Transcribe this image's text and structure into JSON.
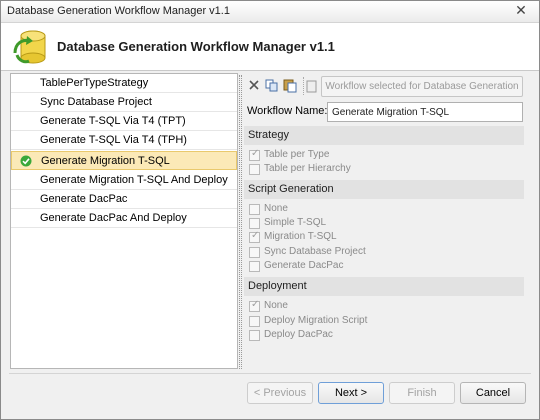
{
  "window": {
    "title": "Database Generation Workflow Manager v1.1",
    "close_glyph": "✕"
  },
  "header": {
    "heading": "Database Generation Workflow Manager v1.1",
    "logo_icon": "database-workflow-icon"
  },
  "steps": [
    {
      "label": "TablePerTypeStrategy"
    },
    {
      "label": "Sync Database Project"
    },
    {
      "label": "Generate T-SQL Via T4 (TPT)"
    },
    {
      "label": "Generate T-SQL Via T4 (TPH)"
    },
    {
      "label": "Generate Migration T-SQL",
      "selected": true
    },
    {
      "label": "Generate Migration T-SQL And Deploy"
    },
    {
      "label": "Generate DacPac"
    },
    {
      "label": "Generate DacPac And Deploy"
    }
  ],
  "toolbar": {
    "workflow_button": "Workflow selected for Database Generation",
    "icons": [
      "delete-icon",
      "copy-icon",
      "paste-icon",
      "document-icon"
    ]
  },
  "workflow": {
    "label": "Workflow Name:",
    "value": "Generate Migration T-SQL"
  },
  "sections": {
    "strategy": {
      "title": "Strategy",
      "options": [
        {
          "label": "Table per Type",
          "checked": true
        },
        {
          "label": "Table per Hierarchy",
          "checked": false
        }
      ]
    },
    "script": {
      "title": "Script Generation",
      "options": [
        {
          "label": "None",
          "checked": false
        },
        {
          "label": "Simple T-SQL",
          "checked": false
        },
        {
          "label": "Migration T-SQL",
          "checked": true
        },
        {
          "label": "Sync Database Project",
          "checked": false
        },
        {
          "label": "Generate DacPac",
          "checked": false
        }
      ]
    },
    "deployment": {
      "title": "Deployment",
      "options": [
        {
          "label": "None",
          "checked": true
        },
        {
          "label": "Deploy Migration Script",
          "checked": false
        },
        {
          "label": "Deploy DacPac",
          "checked": false
        }
      ]
    }
  },
  "buttons": {
    "previous": "< Previous",
    "next": "Next >",
    "finish": "Finish",
    "cancel": "Cancel"
  },
  "colors": {
    "selected_bg": "#fbe9b7",
    "check_green": "#3aa83a",
    "section_bg": "#e2e2e2"
  }
}
